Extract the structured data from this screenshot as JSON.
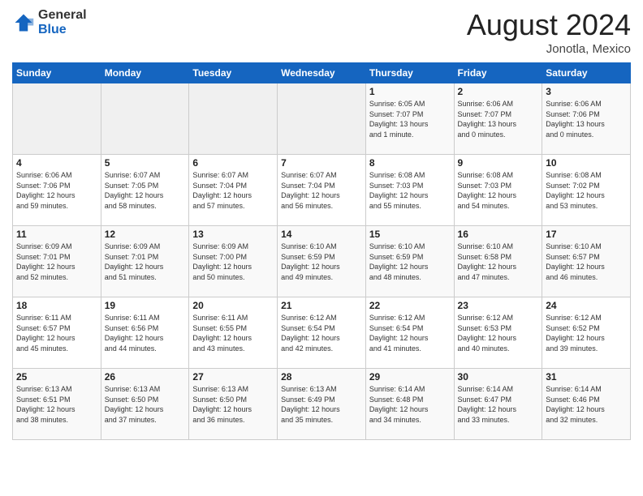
{
  "logo": {
    "general": "General",
    "blue": "Blue"
  },
  "header": {
    "month": "August 2024",
    "location": "Jonotla, Mexico"
  },
  "weekdays": [
    "Sunday",
    "Monday",
    "Tuesday",
    "Wednesday",
    "Thursday",
    "Friday",
    "Saturday"
  ],
  "weeks": [
    [
      {
        "day": "",
        "info": ""
      },
      {
        "day": "",
        "info": ""
      },
      {
        "day": "",
        "info": ""
      },
      {
        "day": "",
        "info": ""
      },
      {
        "day": "1",
        "info": "Sunrise: 6:05 AM\nSunset: 7:07 PM\nDaylight: 13 hours\nand 1 minute."
      },
      {
        "day": "2",
        "info": "Sunrise: 6:06 AM\nSunset: 7:07 PM\nDaylight: 13 hours\nand 0 minutes."
      },
      {
        "day": "3",
        "info": "Sunrise: 6:06 AM\nSunset: 7:06 PM\nDaylight: 13 hours\nand 0 minutes."
      }
    ],
    [
      {
        "day": "4",
        "info": "Sunrise: 6:06 AM\nSunset: 7:06 PM\nDaylight: 12 hours\nand 59 minutes."
      },
      {
        "day": "5",
        "info": "Sunrise: 6:07 AM\nSunset: 7:05 PM\nDaylight: 12 hours\nand 58 minutes."
      },
      {
        "day": "6",
        "info": "Sunrise: 6:07 AM\nSunset: 7:04 PM\nDaylight: 12 hours\nand 57 minutes."
      },
      {
        "day": "7",
        "info": "Sunrise: 6:07 AM\nSunset: 7:04 PM\nDaylight: 12 hours\nand 56 minutes."
      },
      {
        "day": "8",
        "info": "Sunrise: 6:08 AM\nSunset: 7:03 PM\nDaylight: 12 hours\nand 55 minutes."
      },
      {
        "day": "9",
        "info": "Sunrise: 6:08 AM\nSunset: 7:03 PM\nDaylight: 12 hours\nand 54 minutes."
      },
      {
        "day": "10",
        "info": "Sunrise: 6:08 AM\nSunset: 7:02 PM\nDaylight: 12 hours\nand 53 minutes."
      }
    ],
    [
      {
        "day": "11",
        "info": "Sunrise: 6:09 AM\nSunset: 7:01 PM\nDaylight: 12 hours\nand 52 minutes."
      },
      {
        "day": "12",
        "info": "Sunrise: 6:09 AM\nSunset: 7:01 PM\nDaylight: 12 hours\nand 51 minutes."
      },
      {
        "day": "13",
        "info": "Sunrise: 6:09 AM\nSunset: 7:00 PM\nDaylight: 12 hours\nand 50 minutes."
      },
      {
        "day": "14",
        "info": "Sunrise: 6:10 AM\nSunset: 6:59 PM\nDaylight: 12 hours\nand 49 minutes."
      },
      {
        "day": "15",
        "info": "Sunrise: 6:10 AM\nSunset: 6:59 PM\nDaylight: 12 hours\nand 48 minutes."
      },
      {
        "day": "16",
        "info": "Sunrise: 6:10 AM\nSunset: 6:58 PM\nDaylight: 12 hours\nand 47 minutes."
      },
      {
        "day": "17",
        "info": "Sunrise: 6:10 AM\nSunset: 6:57 PM\nDaylight: 12 hours\nand 46 minutes."
      }
    ],
    [
      {
        "day": "18",
        "info": "Sunrise: 6:11 AM\nSunset: 6:57 PM\nDaylight: 12 hours\nand 45 minutes."
      },
      {
        "day": "19",
        "info": "Sunrise: 6:11 AM\nSunset: 6:56 PM\nDaylight: 12 hours\nand 44 minutes."
      },
      {
        "day": "20",
        "info": "Sunrise: 6:11 AM\nSunset: 6:55 PM\nDaylight: 12 hours\nand 43 minutes."
      },
      {
        "day": "21",
        "info": "Sunrise: 6:12 AM\nSunset: 6:54 PM\nDaylight: 12 hours\nand 42 minutes."
      },
      {
        "day": "22",
        "info": "Sunrise: 6:12 AM\nSunset: 6:54 PM\nDaylight: 12 hours\nand 41 minutes."
      },
      {
        "day": "23",
        "info": "Sunrise: 6:12 AM\nSunset: 6:53 PM\nDaylight: 12 hours\nand 40 minutes."
      },
      {
        "day": "24",
        "info": "Sunrise: 6:12 AM\nSunset: 6:52 PM\nDaylight: 12 hours\nand 39 minutes."
      }
    ],
    [
      {
        "day": "25",
        "info": "Sunrise: 6:13 AM\nSunset: 6:51 PM\nDaylight: 12 hours\nand 38 minutes."
      },
      {
        "day": "26",
        "info": "Sunrise: 6:13 AM\nSunset: 6:50 PM\nDaylight: 12 hours\nand 37 minutes."
      },
      {
        "day": "27",
        "info": "Sunrise: 6:13 AM\nSunset: 6:50 PM\nDaylight: 12 hours\nand 36 minutes."
      },
      {
        "day": "28",
        "info": "Sunrise: 6:13 AM\nSunset: 6:49 PM\nDaylight: 12 hours\nand 35 minutes."
      },
      {
        "day": "29",
        "info": "Sunrise: 6:14 AM\nSunset: 6:48 PM\nDaylight: 12 hours\nand 34 minutes."
      },
      {
        "day": "30",
        "info": "Sunrise: 6:14 AM\nSunset: 6:47 PM\nDaylight: 12 hours\nand 33 minutes."
      },
      {
        "day": "31",
        "info": "Sunrise: 6:14 AM\nSunset: 6:46 PM\nDaylight: 12 hours\nand 32 minutes."
      }
    ]
  ]
}
